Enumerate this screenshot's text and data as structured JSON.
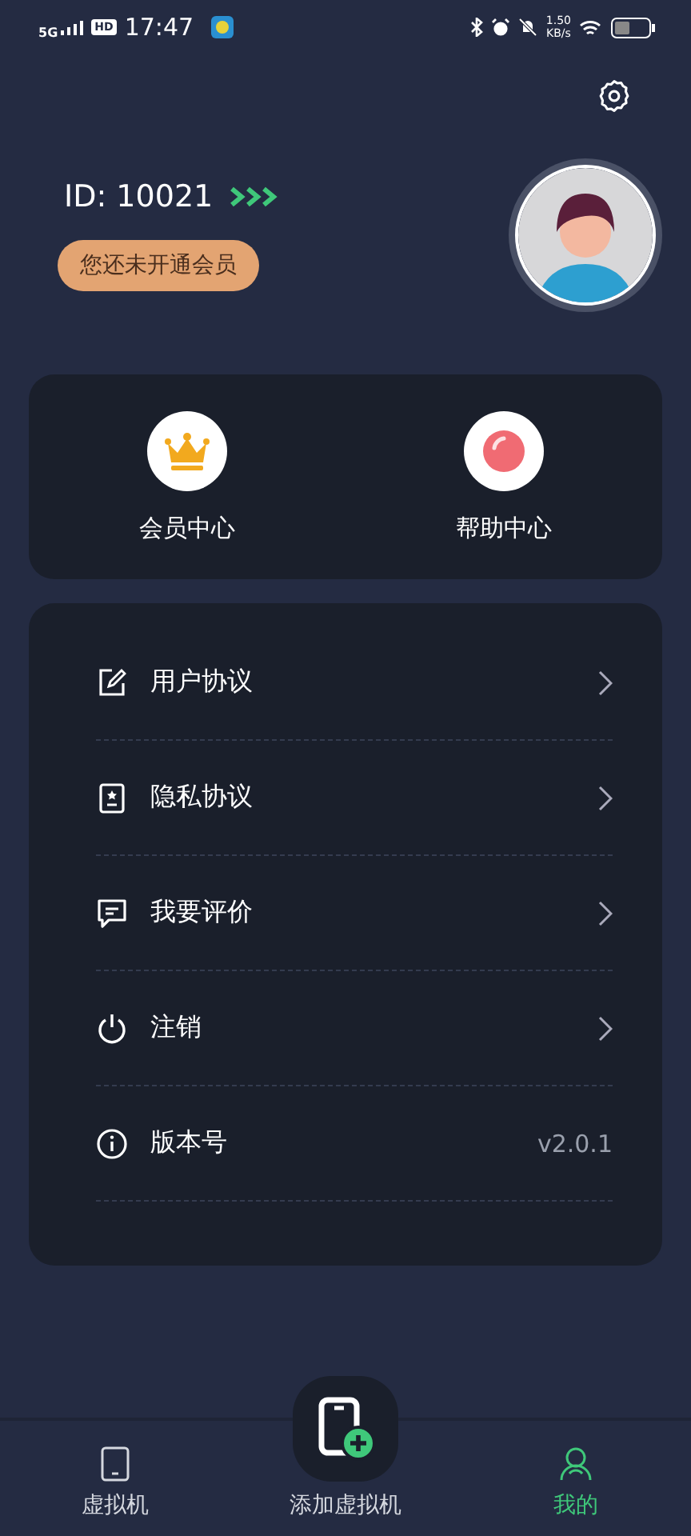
{
  "status_bar": {
    "network": "5G",
    "hd": "HD",
    "time": "17:47",
    "speed": "1.50",
    "speed_unit": "KB/s"
  },
  "profile": {
    "id_label": "ID:",
    "id": "10021",
    "membership": "您还未开通会员"
  },
  "shortcuts": [
    {
      "label": "会员中心",
      "kind": "crown"
    },
    {
      "label": "帮助中心",
      "kind": "help"
    }
  ],
  "menu": [
    {
      "label": "用户协议",
      "kind": "link"
    },
    {
      "label": "隐私协议",
      "kind": "link"
    },
    {
      "label": "我要评价",
      "kind": "link"
    },
    {
      "label": "注销",
      "kind": "link"
    },
    {
      "label": "版本号",
      "kind": "value",
      "value": "v2.0.1"
    }
  ],
  "bottom_nav": [
    {
      "label": "虚拟机",
      "kind": "tablet",
      "selected": false
    },
    {
      "label": "添加虚拟机",
      "kind": "add",
      "selected": false
    },
    {
      "label": "我的",
      "kind": "user",
      "selected": true
    }
  ]
}
